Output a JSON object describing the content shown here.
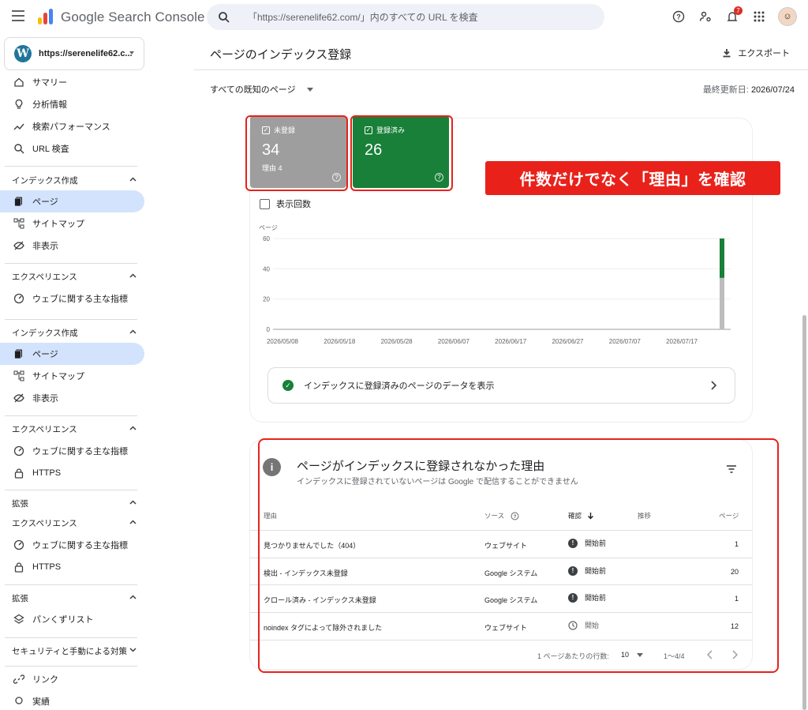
{
  "header": {
    "brand": "Google Search Console",
    "search_placeholder": "「https://serenelife62.com/」内のすべての URL を検査",
    "notification_count": "7"
  },
  "sidebar": {
    "property": "https://serenelife62.c...",
    "items": [
      {
        "type": "item",
        "label": "サマリー",
        "icon": "home-icon"
      },
      {
        "type": "item",
        "label": "分析情報",
        "icon": "lightbulb-icon"
      },
      {
        "type": "item",
        "label": "検索パフォーマンス",
        "icon": "trend-icon"
      },
      {
        "type": "item",
        "label": "URL 検査",
        "icon": "search-icon"
      },
      {
        "type": "head",
        "label": "インデックス作成",
        "open": true
      },
      {
        "type": "item",
        "label": "ページ",
        "icon": "pages-icon",
        "active": true
      },
      {
        "type": "item",
        "label": "サイトマップ",
        "icon": "sitemap-icon"
      },
      {
        "type": "item",
        "label": "非表示",
        "icon": "hidden-icon"
      },
      {
        "type": "head",
        "label": "エクスペリエンス",
        "open": true
      },
      {
        "type": "item",
        "label": "ウェブに関する主な指標",
        "icon": "gauge-icon"
      },
      {
        "type": "head",
        "label": "インデックス作成",
        "open": true
      },
      {
        "type": "item",
        "label": "ページ",
        "icon": "pages-icon",
        "active": true
      },
      {
        "type": "item",
        "label": "サイトマップ",
        "icon": "sitemap-icon"
      },
      {
        "type": "item",
        "label": "非表示",
        "icon": "hidden-icon"
      },
      {
        "type": "head",
        "label": "エクスペリエンス",
        "open": true
      },
      {
        "type": "item",
        "label": "ウェブに関する主な指標",
        "icon": "gauge-icon"
      },
      {
        "type": "item",
        "label": "HTTPS",
        "icon": "lock-icon"
      },
      {
        "type": "head",
        "label": "拡張",
        "open": true
      },
      {
        "type": "head",
        "label": "エクスペリエンス",
        "open": true
      },
      {
        "type": "item",
        "label": "ウェブに関する主な指標",
        "icon": "gauge-icon"
      },
      {
        "type": "item",
        "label": "HTTPS",
        "icon": "lock-icon"
      },
      {
        "type": "head",
        "label": "拡張",
        "open": true
      },
      {
        "type": "item",
        "label": "パンくずリスト",
        "icon": "layers-icon"
      },
      {
        "type": "head",
        "label": "セキュリティと手動による対策",
        "open": false
      },
      {
        "type": "item",
        "label": "リンク",
        "icon": "link-icon"
      },
      {
        "type": "item",
        "label": "実績",
        "icon": "award-icon"
      }
    ]
  },
  "main": {
    "title": "ページのインデックス登録",
    "export": "エクスポート",
    "filter": "すべての既知のページ",
    "updated_label": "最終更新日:",
    "updated_value": "2026/07/24",
    "not_indexed": {
      "label": "未登録",
      "value": "34",
      "sub": "理由 4"
    },
    "indexed": {
      "label": "登録済み",
      "value": "26"
    },
    "callout": "件数だけでなく「理由」を確認",
    "impressions_label": "表示回数",
    "view_indexed": "インデックスに登録済みのページのデータを表示"
  },
  "chart_data": {
    "type": "bar",
    "ylabel": "ページ",
    "ylim": [
      0,
      60
    ],
    "yticks": [
      0,
      20,
      40,
      60
    ],
    "xticks": [
      "2026/05/08",
      "2026/05/18",
      "2026/05/28",
      "2026/06/07",
      "2026/06/17",
      "2026/06/27",
      "2026/07/07",
      "2026/07/17"
    ],
    "categories": [
      "2026/07/24"
    ],
    "series": [
      {
        "name": "未登録",
        "color": "#bdbdbd",
        "values": [
          34
        ]
      },
      {
        "name": "登録済み",
        "color": "#188038",
        "values": [
          26
        ]
      }
    ]
  },
  "table": {
    "title": "ページがインデックスに登録されなかった理由",
    "subtitle": "インデックスに登録されていないページは Google で配信することができません",
    "headers": {
      "reason": "理由",
      "source": "ソース",
      "validation": "確認",
      "trend": "推移",
      "pages": "ページ"
    },
    "rows": [
      {
        "reason": "見つかりませんでした（404）",
        "source": "ウェブサイト",
        "status": "開始前",
        "status_icon": "exclamation-icon",
        "pages": "1"
      },
      {
        "reason": "検出 - インデックス未登録",
        "source": "Google システム",
        "status": "開始前",
        "status_icon": "exclamation-icon",
        "pages": "20"
      },
      {
        "reason": "クロール済み - インデックス未登録",
        "source": "Google システム",
        "status": "開始前",
        "status_icon": "exclamation-icon",
        "pages": "1"
      },
      {
        "reason": "noindex タグによって除外されました",
        "source": "ウェブサイト",
        "status": "開始",
        "status_icon": "clock-icon",
        "pages": "12"
      }
    ],
    "rows_per_page_label": "1 ページあたりの行数:",
    "rows_per_page": "10",
    "range": "1〜4/4"
  }
}
